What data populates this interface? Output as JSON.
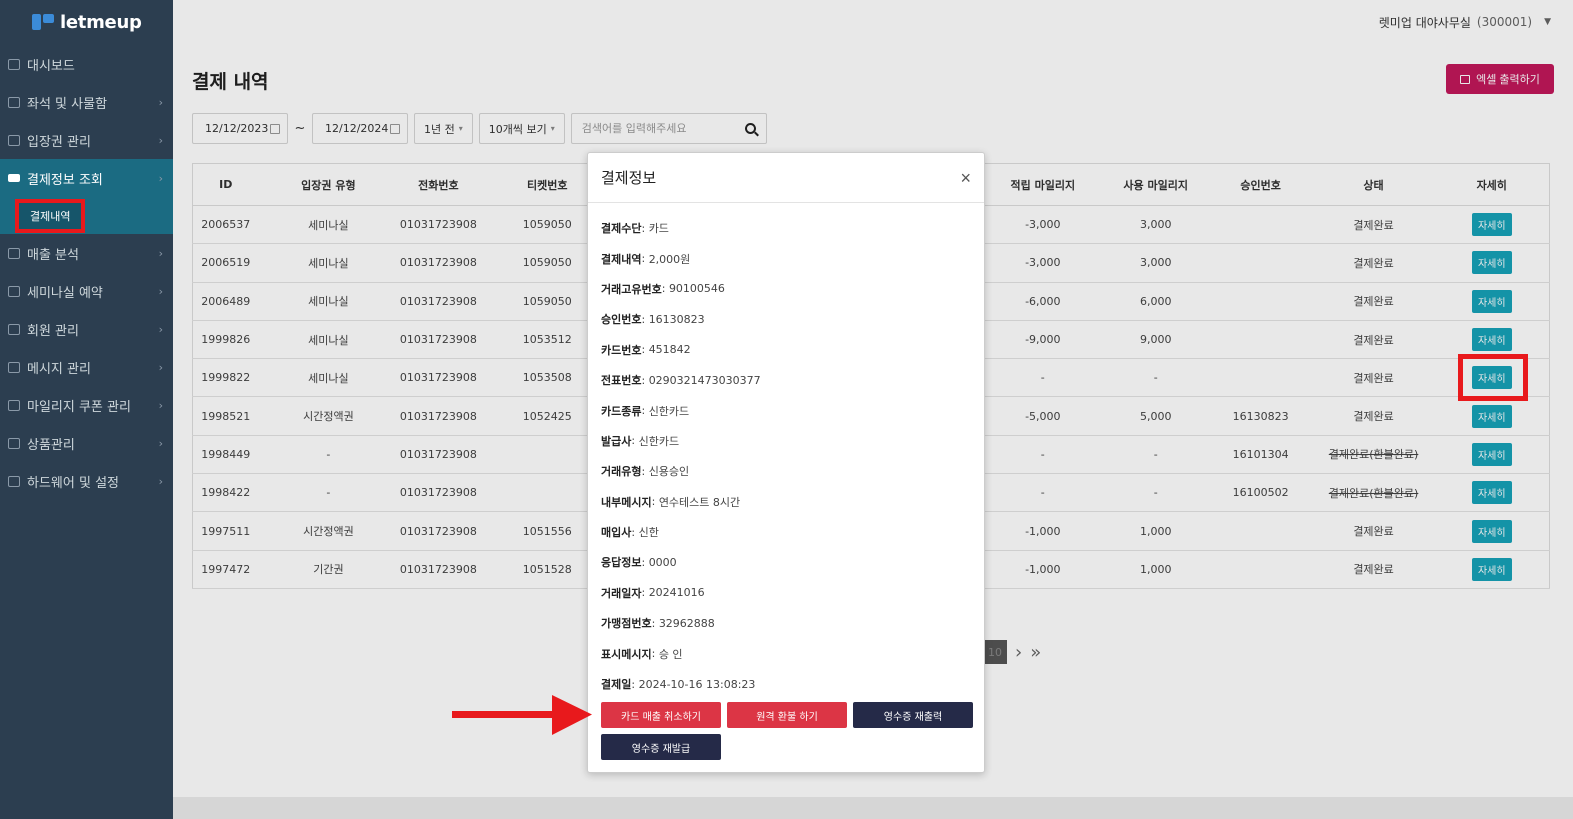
{
  "brand": {
    "name": "letmeup"
  },
  "topbar": {
    "store_name": "렛미업 대야사무실",
    "store_code": "(300001)"
  },
  "sidebar": {
    "items": [
      {
        "label": "대시보드",
        "icon": "grid-icon",
        "has_arrow": false
      },
      {
        "label": "좌석 및 사물함",
        "icon": "seat-icon",
        "has_arrow": true
      },
      {
        "label": "입장권 관리",
        "icon": "ticket-icon",
        "has_arrow": true
      },
      {
        "label": "결제정보 조회",
        "icon": "card-icon",
        "has_arrow": true,
        "active": true
      },
      {
        "label": "매출 분석",
        "icon": "chart-icon",
        "has_arrow": true
      },
      {
        "label": "세미나실 예약",
        "icon": "calendar-icon",
        "has_arrow": true
      },
      {
        "label": "회원 관리",
        "icon": "users-icon",
        "has_arrow": true
      },
      {
        "label": "메시지 관리",
        "icon": "mail-icon",
        "has_arrow": true
      },
      {
        "label": "마일리지 쿠폰 관리",
        "icon": "coupon-icon",
        "has_arrow": true
      },
      {
        "label": "상품관리",
        "icon": "bag-icon",
        "has_arrow": true
      },
      {
        "label": "하드웨어 및 설정",
        "icon": "gear-icon",
        "has_arrow": true
      }
    ],
    "sub_item": "결제내역"
  },
  "page": {
    "title": "결제 내역",
    "excel_button": "엑셀 출력하기"
  },
  "filters": {
    "date_from": "12/12/2023",
    "date_to": "12/12/2024",
    "tilde": "~",
    "period": "1년 전",
    "page_size": "10개씩 보기",
    "search_placeholder": "검색어를 입력해주세요"
  },
  "table": {
    "columns": [
      "ID",
      "입장권 유형",
      "전화번호",
      "티켓번호",
      "",
      "",
      "",
      "적립 마일리지",
      "사용 마일리지",
      "승인번호",
      "상태",
      "자세히"
    ],
    "rows": [
      {
        "id": "2006537",
        "type": "세미나실",
        "type_class": "t-semi",
        "phone": "01031723908",
        "ticket": "1059050",
        "earn": "-3,000",
        "use": "3,000",
        "approval": "",
        "status": "결제완료",
        "status_refund": false
      },
      {
        "id": "2006519",
        "type": "세미나실",
        "type_class": "t-semi",
        "phone": "01031723908",
        "ticket": "1059050",
        "earn": "-3,000",
        "use": "3,000",
        "approval": "",
        "status": "결제완료",
        "status_refund": false
      },
      {
        "id": "2006489",
        "type": "세미나실",
        "type_class": "t-semi",
        "phone": "01031723908",
        "ticket": "1059050",
        "earn": "-6,000",
        "use": "6,000",
        "approval": "",
        "status": "결제완료",
        "status_refund": false
      },
      {
        "id": "1999826",
        "type": "세미나실",
        "type_class": "t-semi",
        "phone": "01031723908",
        "ticket": "1053512",
        "earn": "-9,000",
        "use": "9,000",
        "approval": "",
        "status": "결제완료",
        "status_refund": false
      },
      {
        "id": "1999822",
        "type": "세미나실",
        "type_class": "t-semi",
        "phone": "01031723908",
        "ticket": "1053508",
        "earn": "-",
        "use": "-",
        "approval": "",
        "status": "결제완료",
        "status_refund": false
      },
      {
        "id": "1998521",
        "type": "시간정액권",
        "type_class": "t-time",
        "phone": "01031723908",
        "ticket": "1052425",
        "earn": "-5,000",
        "use": "5,000",
        "approval": "16130823",
        "status": "결제완료",
        "status_refund": false
      },
      {
        "id": "1998449",
        "type": "-",
        "type_class": "",
        "phone": "01031723908",
        "ticket": "",
        "earn": "-",
        "use": "-",
        "approval": "16101304",
        "status": "결제완료(환불완료)",
        "status_refund": true
      },
      {
        "id": "1998422",
        "type": "-",
        "type_class": "",
        "phone": "01031723908",
        "ticket": "",
        "earn": "-",
        "use": "-",
        "approval": "16100502",
        "status": "결제완료(환불완료)",
        "status_refund": true
      },
      {
        "id": "1997511",
        "type": "시간정액권",
        "type_class": "t-time",
        "phone": "01031723908",
        "ticket": "1051556",
        "earn": "-1,000",
        "use": "1,000",
        "approval": "",
        "status": "결제완료",
        "status_refund": false
      },
      {
        "id": "1997472",
        "type": "기간권",
        "type_class": "t-period",
        "phone": "01031723908",
        "ticket": "1051528",
        "earn": "-1,000",
        "use": "1,000",
        "approval": "",
        "status": "결제완료",
        "status_refund": false
      }
    ],
    "detail_label": "자세히"
  },
  "pagination": {
    "current": "10"
  },
  "modal": {
    "title": "결제정보",
    "close": "×",
    "fields": [
      {
        "key": "결제수단",
        "value": "카드"
      },
      {
        "key": "결제내역",
        "value": "2,000원"
      },
      {
        "key": "거래고유번호",
        "value": "90100546"
      },
      {
        "key": "승인번호",
        "value": "16130823"
      },
      {
        "key": "카드번호",
        "value": "451842"
      },
      {
        "key": "전표번호",
        "value": "0290321473030377"
      },
      {
        "key": "카드종류",
        "value": "신한카드"
      },
      {
        "key": "발급사",
        "value": "신한카드"
      },
      {
        "key": "거래유형",
        "value": "신용승인"
      },
      {
        "key": "내부메시지",
        "value": "연수테스트 8시간"
      },
      {
        "key": "매입사",
        "value": "신한"
      },
      {
        "key": "응답정보",
        "value": "0000"
      },
      {
        "key": "거래일자",
        "value": "20241016"
      },
      {
        "key": "가맹점번호",
        "value": "32962888"
      },
      {
        "key": "표시메시지",
        "value": "승 인"
      },
      {
        "key": "결제일",
        "value": "2024-10-16 13:08:23"
      }
    ],
    "buttons": {
      "cancel_card": "카드 매출 취소하기",
      "remote_refund": "원격 환불 하기",
      "reprint": "영수증 재출력",
      "reissue": "영수증 재발급"
    }
  },
  "colors": {
    "sidebar": "#2c3e50",
    "accent": "#17a2b8",
    "excel": "#c2185b",
    "danger": "#dc3545",
    "navy": "#252a48",
    "highlight": "#e8191c"
  }
}
